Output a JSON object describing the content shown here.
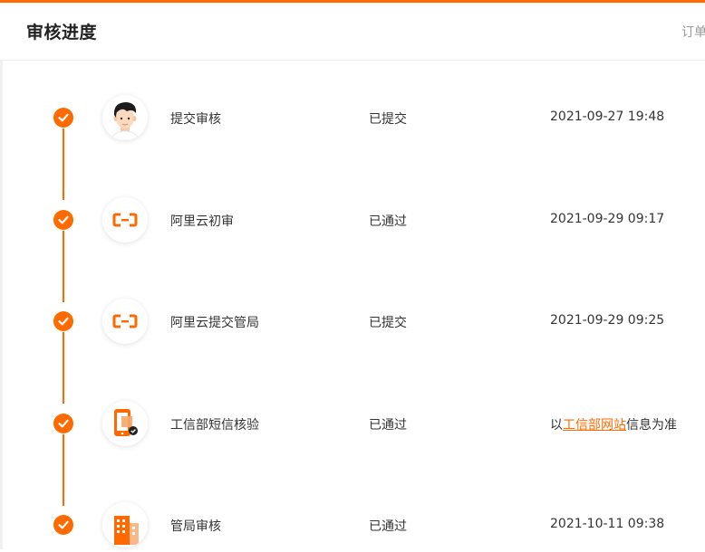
{
  "header": {
    "title": "审核进度",
    "right_link": "订单"
  },
  "colors": {
    "accent": "#ff6a00",
    "text": "#333333",
    "muted": "#999999"
  },
  "steps": [
    {
      "icon": "user-avatar-icon",
      "name": "提交审核",
      "status": "已提交",
      "time": "2021-09-27 19:48"
    },
    {
      "icon": "aliyun-logo-icon",
      "name": "阿里云初审",
      "status": "已通过",
      "time": "2021-09-29 09:17"
    },
    {
      "icon": "aliyun-logo-icon",
      "name": "阿里云提交管局",
      "status": "已提交",
      "time": "2021-09-29 09:25"
    },
    {
      "icon": "phone-verify-icon",
      "name": "工信部短信核验",
      "status": "已通过",
      "time_prefix": "以",
      "time_link": "工信部网站",
      "time_suffix": "信息为准"
    },
    {
      "icon": "building-icon",
      "name": "管局审核",
      "status": "已通过",
      "time": "2021-10-11 09:38"
    }
  ]
}
